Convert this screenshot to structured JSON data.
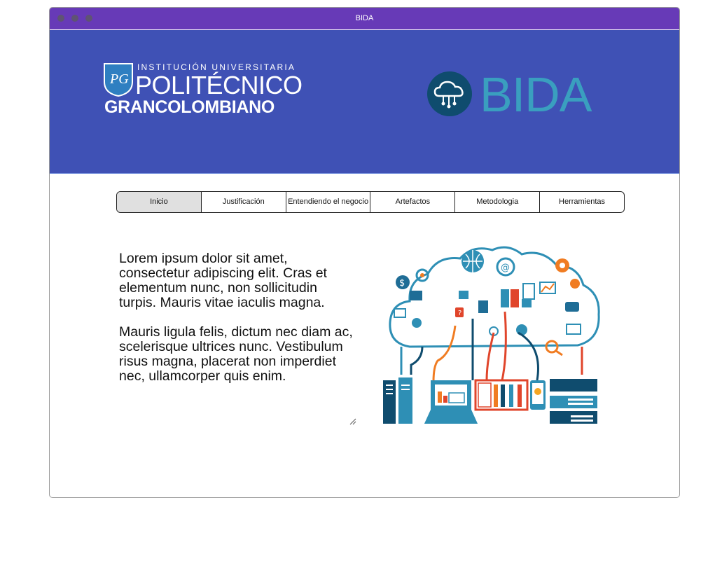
{
  "window": {
    "title": "BIDA"
  },
  "header": {
    "left_logo": {
      "line1": "INSTITUCIÓN UNIVERSITARIA",
      "line2": "POLITÉCNICO",
      "line3": "GRANCOLOMBIANO"
    },
    "right_logo": {
      "text": "BIDA"
    }
  },
  "nav": {
    "tabs": [
      {
        "label": "Inicio"
      },
      {
        "label": "Justificación"
      },
      {
        "label": "Entendiendo el negocio"
      },
      {
        "label": "Artefactos"
      },
      {
        "label": "Metodologia"
      },
      {
        "label": "Herramientas"
      }
    ],
    "selected": "Inicio"
  },
  "content": {
    "paragraph1": "Lorem ipsum dolor sit amet, consectetur adipiscing elit. Cras et elementum nunc, non sollicitudin turpis. Mauris vitae iaculis magna.",
    "paragraph2": "Mauris ligula felis, dictum nec diam ac, scelerisque ultrices nunc. Vestibulum risus magna, placerat non imperdiet nec, ullamcorper quis enim."
  },
  "colors": {
    "titlebar": "#673ab7",
    "header": "#3f51b5",
    "bida_accent": "#3a9fbf",
    "illustration_blue": "#2e8fb5",
    "illustration_orange": "#f07c22",
    "illustration_red": "#e0452b",
    "illustration_navy": "#0f4c6e"
  }
}
